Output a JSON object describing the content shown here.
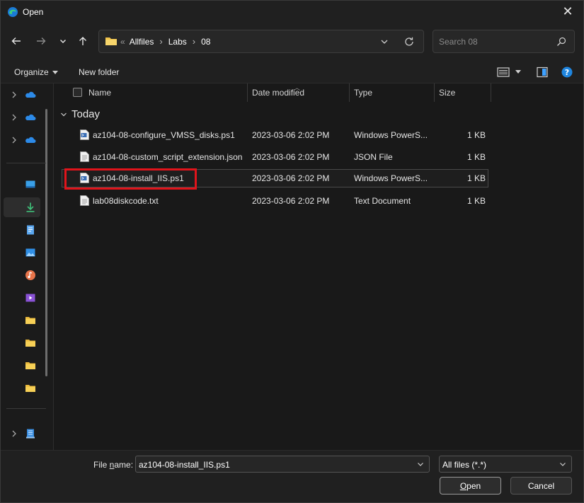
{
  "window": {
    "title": "Open",
    "close_glyph": "✕"
  },
  "address": {
    "prefix": "«",
    "crumbs": [
      "Allfiles",
      "Labs",
      "08"
    ],
    "separator": "›"
  },
  "search": {
    "placeholder": "Search 08"
  },
  "toolbar": {
    "organize_label": "Organize",
    "new_folder_label": "New folder"
  },
  "columns": {
    "name": "Name",
    "date": "Date modified",
    "type": "Type",
    "size": "Size"
  },
  "group": {
    "label": "Today"
  },
  "files": [
    {
      "name": "az104-08-configure_VMSS_disks.ps1",
      "date": "2023-03-06 2:02 PM",
      "type": "Windows PowerS...",
      "size": "1 KB",
      "icon": "powershell-file-icon"
    },
    {
      "name": "az104-08-custom_script_extension.json",
      "date": "2023-03-06 2:02 PM",
      "type": "JSON File",
      "size": "1 KB",
      "icon": "text-file-icon"
    },
    {
      "name": "az104-08-install_IIS.ps1",
      "date": "2023-03-06 2:02 PM",
      "type": "Windows PowerS...",
      "size": "1 KB",
      "icon": "powershell-file-icon",
      "selected": true
    },
    {
      "name": "lab08diskcode.txt",
      "date": "2023-03-06 2:02 PM",
      "type": "Text Document",
      "size": "1 KB",
      "icon": "text-file-icon"
    }
  ],
  "footer": {
    "file_name_label_a": "File ",
    "file_name_label_u": "n",
    "file_name_label_b": "ame:",
    "file_name_value": "az104-08-install_IIS.ps1",
    "filter_value": "All files (*.*)",
    "open_label_u": "O",
    "open_label_rest": "pen",
    "cancel_label": "Cancel"
  },
  "colors": {
    "highlight": "#e1141b",
    "accent": "#0078d4",
    "onedrive": "#2c8ae8"
  },
  "nav_icons": [
    "onedrive-icon",
    "onedrive-icon",
    "onedrive-icon",
    "desktop-icon",
    "downloads-icon",
    "documents-icon",
    "pictures-icon",
    "music-icon",
    "videos-icon",
    "folder-icon",
    "folder-icon",
    "folder-icon",
    "folder-icon",
    "network-icon"
  ]
}
